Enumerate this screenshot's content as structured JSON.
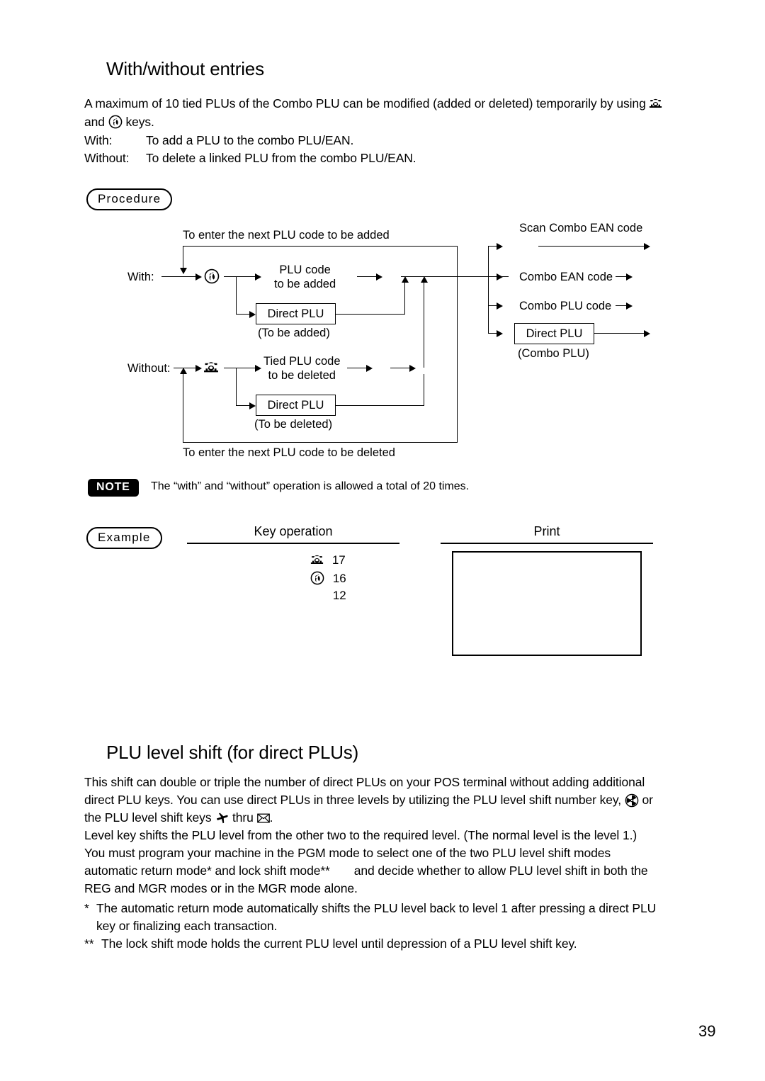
{
  "page": {
    "number": "39"
  },
  "section1": {
    "heading": "With/without entries",
    "intro_a": "A maximum of 10 tied PLUs of the Combo PLU can be modified (added or deleted) temporarily by using",
    "intro_b": "and",
    "intro_c": "keys.",
    "defs": [
      {
        "term": "With:",
        "desc": "To add a PLU to the combo PLU/EAN."
      },
      {
        "term": "Without:",
        "desc": "To delete a linked PLU from the combo PLU/EAN."
      }
    ],
    "procedure_label": "Procedure",
    "diagram": {
      "loop_top_label": "To enter the next PLU code to be added",
      "loop_bottom_label": "To enter the next PLU code to be deleted",
      "with_label": "With:",
      "without_label": "Without:",
      "with_path_line1": "PLU code",
      "with_path_line2": "to be added",
      "with_box": "Direct PLU",
      "with_box_sub": "(To be added)",
      "without_path_line1": "Tied PLU code",
      "without_path_line2": "to be deleted",
      "without_box": "Direct PLU",
      "without_box_sub": "(To be deleted)",
      "out_scan": "Scan Combo EAN code",
      "out_ean": "Combo EAN code",
      "out_plu": "Combo PLU code",
      "out_box": "Direct PLU",
      "out_box_sub": "(Combo PLU)"
    },
    "note": {
      "badge": "NOTE",
      "text": "The “with” and “without” operation is allowed a total of 20 times."
    },
    "example": {
      "label": "Example",
      "key_operation_header": "Key operation",
      "print_header": "Print",
      "rows": [
        {
          "icon": "telephone-key-icon",
          "value": "17"
        },
        {
          "icon": "circled-receiver-key-icon",
          "value": "16"
        },
        {
          "icon": "",
          "value": "12"
        }
      ],
      "print_content": ""
    }
  },
  "section2": {
    "heading": "PLU level shift (for direct PLUs)",
    "para1_a": "This shift can double or triple the number of direct PLUs on your POS terminal without adding additional",
    "para1_b": "direct PLU keys. You can use direct PLUs in three levels by utilizing the PLU level shift number key,",
    "para1_c": "or",
    "para1_d": "the PLU level shift keys",
    "para1_e": "thru",
    "para1_f": ".",
    "para2": "Level key shifts the PLU level from the other two to the required level. (The normal level is the level 1.)",
    "para3": "You must program your machine in the PGM mode to select one of the two PLU level shift modes",
    "para4_a": "automatic return mode* and lock shift mode**",
    "para4_b": "and decide whether to allow PLU level shift in both the",
    "para5": "REG and MGR modes or in the MGR mode alone.",
    "footnote1_marker": "*",
    "footnote1_line1": "The automatic return mode automatically shifts the PLU level back to level 1 after pressing a direct PLU",
    "footnote1_line2": "key or finalizing each transaction.",
    "footnote2_marker": "**",
    "footnote2": "The lock shift mode holds the current PLU level until depression of a PLU level shift key."
  },
  "icons": {
    "telephone": "telephone-key-icon",
    "circled_receiver": "circled-receiver-key-icon",
    "propeller": "propeller-key-icon",
    "airplane": "airplane-key-icon",
    "envelope": "envelope-key-icon"
  },
  "colors": {
    "ink": "#000000",
    "paper": "#ffffff"
  }
}
